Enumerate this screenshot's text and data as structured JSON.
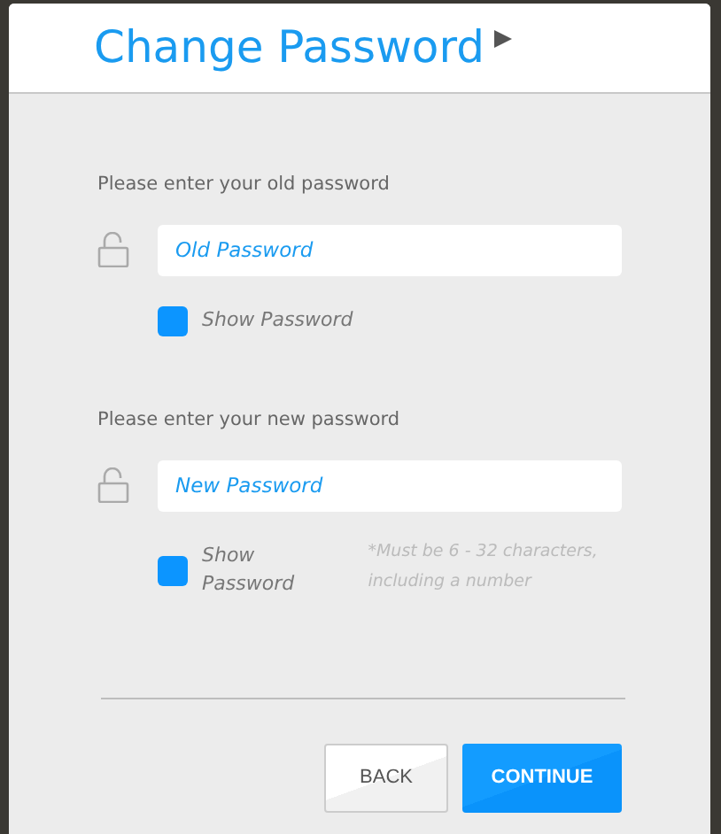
{
  "dialog": {
    "title": "Change Password"
  },
  "sections": [
    {
      "label": "Please enter your old password",
      "field": {
        "placeholder": "Old Password"
      },
      "show_password": {
        "label": "Show Password",
        "checked": false
      }
    },
    {
      "label": "Please enter your new password",
      "field": {
        "placeholder": "New Password"
      },
      "show_password": {
        "label": "Show Password",
        "checked": false
      },
      "hint": "*Must be 6 - 32 characters, including a number"
    }
  ],
  "buttons": [
    {
      "label": "BACK",
      "kind": "secondary"
    },
    {
      "label": "CONTINUE",
      "kind": "primary"
    }
  ]
}
